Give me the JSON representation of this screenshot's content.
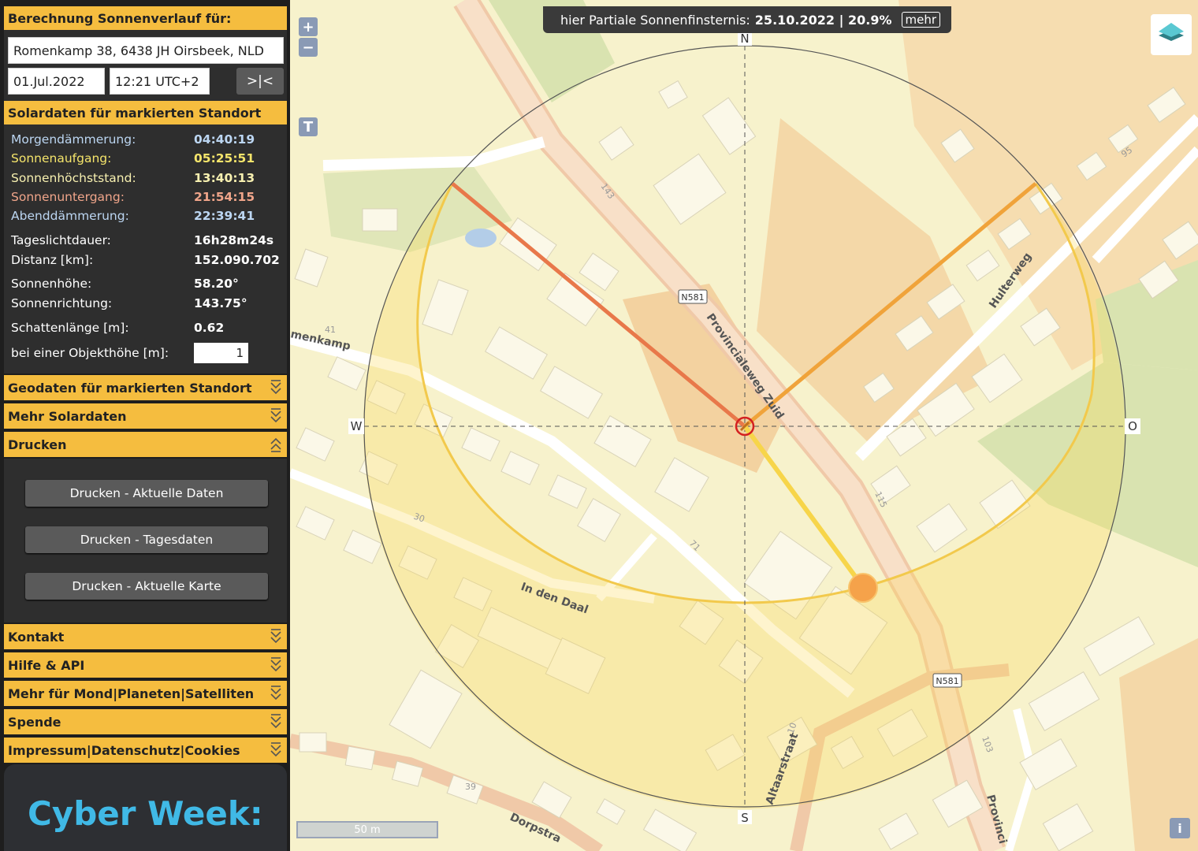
{
  "sidebar": {
    "header_title": "Berechnung Sonnenverlauf für:",
    "address_value": "Romenkamp 38, 6438 JH Oirsbeek, NLD",
    "date_value": "01.Jul.2022",
    "time_value": "12:21 UTC+2",
    "now_button": ">|<",
    "solar_section": "Solardaten für markierten Standort",
    "rows": [
      {
        "label": "Morgendämmerung:",
        "value": "04:40:19",
        "color": "#bcd6f2"
      },
      {
        "label": "Sonnenaufgang:",
        "value": "05:25:51",
        "color": "#f5e56b"
      },
      {
        "label": "Sonnenhöchststand:",
        "value": "13:40:13",
        "color": "#f7f0b0"
      },
      {
        "label": "Sonnenuntergang:",
        "value": "21:54:15",
        "color": "#f0a58a"
      },
      {
        "label": "Abenddämmerung:",
        "value": "22:39:41",
        "color": "#bcd6f2"
      },
      {
        "label": "Tageslichtdauer:",
        "value": "16h28m24s",
        "color": "#ffffff"
      },
      {
        "label": "Distanz [km]:",
        "value": "152.090.702",
        "color": "#ffffff"
      },
      {
        "label": "Sonnenhöhe:",
        "value": "58.20°",
        "color": "#ffffff"
      },
      {
        "label": "Sonnenrichtung:",
        "value": "143.75°",
        "color": "#ffffff"
      },
      {
        "label": "Schattenlänge [m]:",
        "value": "0.62",
        "color": "#ffffff"
      }
    ],
    "object_height_label": "bei einer Objekthöhe [m]:",
    "object_height_value": "1",
    "sections": [
      "Geodaten für markierten Standort",
      "Mehr Solardaten",
      "Drucken"
    ],
    "print_buttons": [
      "Drucken - Aktuelle Daten",
      "Drucken - Tagesdaten",
      "Drucken - Aktuelle Karte"
    ],
    "bottom_sections": [
      "Kontakt",
      "Hilfe & API",
      "Mehr für Mond|Planeten|Satelliten",
      "Spende",
      "Impressum|Datenschutz|Cookies"
    ],
    "ad_text": "Cyber Week:"
  },
  "banner": {
    "prefix": "hier Partiale Sonnenfinsternis:",
    "value": "25.10.2022 | 20.9%",
    "more": "mehr"
  },
  "map": {
    "zoom_in": "+",
    "zoom_out": "−",
    "toggle": "T",
    "compass": {
      "n": "N",
      "s": "S",
      "w": "W",
      "o": "O"
    },
    "scale": "50 m",
    "info": "i",
    "labels": {
      "street1": "Provincialeweg Zuid",
      "street2": "Hulterweg",
      "street3": "In den Daal",
      "street4": "Altaarstraat",
      "street5": "Dorpstra",
      "street6": "menkamp",
      "street7": "Provinci",
      "road_badge": "N581",
      "n143": "143",
      "n41": "41",
      "n30": "30",
      "n71": "71",
      "n115": "115",
      "n10": "10",
      "n39": "39",
      "n103": "103",
      "n95": "95"
    },
    "colors": {
      "sunrise": "#f0a33a",
      "sunset": "#e8784a",
      "current": "#f7d54a",
      "sun": "#f5a24a"
    }
  }
}
